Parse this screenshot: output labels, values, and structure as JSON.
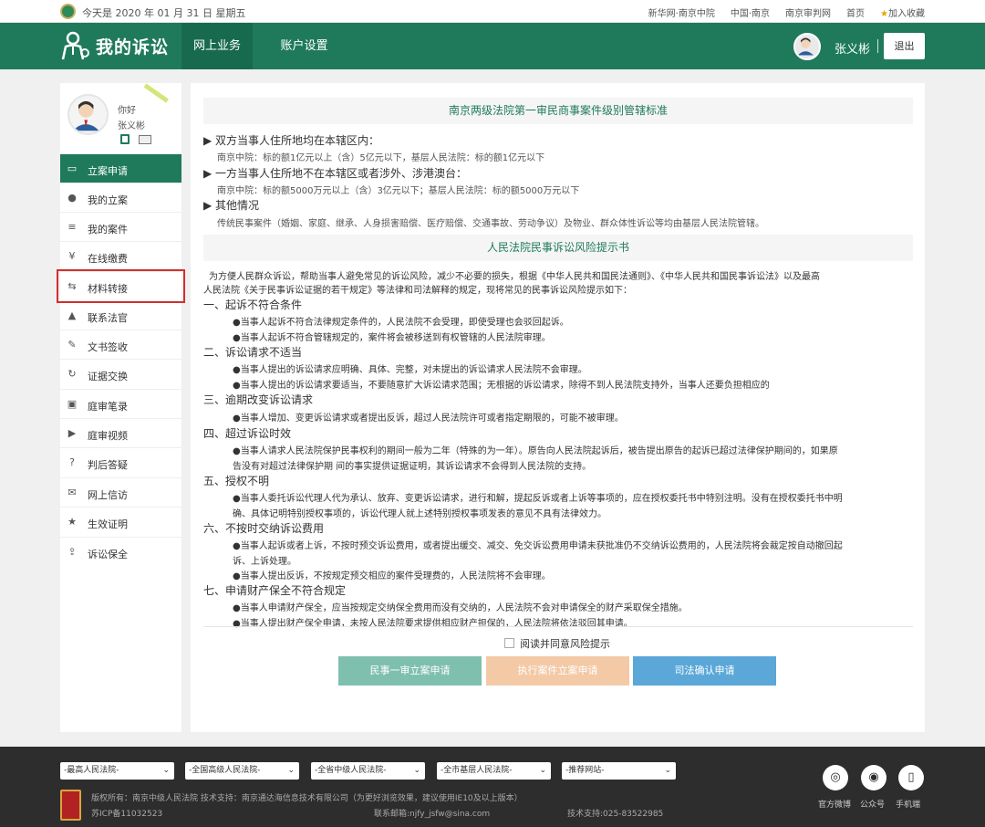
{
  "topbar": {
    "date": "今天是 2020 年 01 月 31 日 星期五",
    "links": [
      "新华网·南京中院",
      "中国·南京",
      "南京审判网",
      "首页"
    ],
    "favorite": "加入收藏"
  },
  "header": {
    "title": "我的诉讼",
    "tabs": [
      "网上业务",
      "账户设置"
    ],
    "user_name": "张义彬",
    "logout": "退出"
  },
  "sidebar": {
    "greeting": "你好",
    "name": "张义彬",
    "items": [
      {
        "label": "立案申请",
        "icon": "monitor-icon"
      },
      {
        "label": "我的立案",
        "icon": "user-icon"
      },
      {
        "label": "我的案件",
        "icon": "document-icon"
      },
      {
        "label": "在线缴费",
        "icon": "yen-icon"
      },
      {
        "label": "材料转接",
        "icon": "transfer-icon"
      },
      {
        "label": "联系法官",
        "icon": "contacts-icon"
      },
      {
        "label": "文书签收",
        "icon": "edit-icon"
      },
      {
        "label": "证据交换",
        "icon": "refresh-icon"
      },
      {
        "label": "庭审笔录",
        "icon": "notes-icon"
      },
      {
        "label": "庭审视频",
        "icon": "video-icon"
      },
      {
        "label": "判后答疑",
        "icon": "question-icon"
      },
      {
        "label": "网上信访",
        "icon": "mail-icon"
      },
      {
        "label": "生效证明",
        "icon": "star-icon"
      },
      {
        "label": "诉讼保全",
        "icon": "upload-icon"
      }
    ]
  },
  "main": {
    "section1_title": "南京两级法院第一审民商事案件级别管辖标准",
    "s1": [
      "▶ 双方当事人住所地均在本辖区内：",
      "南京中院：标的额1亿元以上（含）5亿元以下，基层人民法院：标的额1亿元以下",
      "▶ 一方当事人住所地不在本辖区或者涉外、涉港澳台：",
      "南京中院：标的额5000万元以上（含）3亿元以下；基层人民法院：标的额5000万元以下",
      "▶ 其他情况",
      "传统民事案件（婚姻、家庭、继承、人身损害赔偿、医疗赔偿、交通事故、劳动争议）及物业、群众体性诉讼等均由基层人民法院管辖。"
    ],
    "section2_title": "人民法院民事诉讼风险提示书",
    "intro": [
      "为方便人民群众诉讼，帮助当事人避免常见的诉讼风险，减少不必要的损失，根据《中华人民共和国民法通则》、《中华人民共和国民事诉讼法》以及最高",
      "人民法院《关于民事诉讼证据的若干规定》等法律和司法解释的规定，现将常见的民事诉讼风险提示如下："
    ],
    "points": [
      {
        "title": "一、起诉不符合条件",
        "lines": [
          "●当事人起诉不符合法律规定条件的，人民法院不会受理，即使受理也会驳回起诉。",
          "●当事人起诉不符合管辖规定的，案件将会被移送到有权管辖的人民法院审理。"
        ]
      },
      {
        "title": "二、诉讼请求不适当",
        "lines": [
          "●当事人提出的诉讼请求应明确、具体、完整，对未提出的诉讼请求人民法院不会审理。",
          "●当事人提出的诉讼请求要适当，不要随意扩大诉讼请求范围；无根据的诉讼请求，除得不到人民法院支持外，当事人还要负担相应的"
        ]
      },
      {
        "title": "三、逾期改变诉讼请求",
        "lines": [
          "●当事人增加、变更诉讼请求或者提出反诉，超过人民法院许可或者指定期限的，可能不被审理。"
        ]
      },
      {
        "title": "四、超过诉讼时效",
        "lines": [
          "●当事人请求人民法院保护民事权利的期间一般为二年（特殊的为一年）。原告向人民法院起诉后，被告提出原告的起诉已超过法律保护期间的，如果原",
          "告没有对超过法律保护期 间的事实提供证据证明，其诉讼请求不会得到人民法院的支持。"
        ]
      },
      {
        "title": "五、授权不明",
        "lines": [
          "●当事人委托诉讼代理人代为承认、放弃、变更诉讼请求，进行和解，提起反诉或者上诉等事项的，应在授权委托书中特别注明。没有在授权委托书中明",
          "确、具体记明特别授权事项的，诉讼代理人就上述特别授权事项发表的意见不具有法律效力。"
        ]
      },
      {
        "title": "六、不按时交纳诉讼费用",
        "lines": [
          "●当事人起诉或者上诉，不按时预交诉讼费用，或者提出缓交、减交、免交诉讼费用申请未获批准仍不交纳诉讼费用的，人民法院将会裁定按自动撤回起",
          "诉、上诉处理。",
          "●当事人提出反诉，不按规定预交相应的案件受理费的，人民法院将不会审理。"
        ]
      },
      {
        "title": "七、申请财产保全不符合规定",
        "lines": [
          "●当事人申请财产保全，应当按规定交纳保全费用而没有交纳的，人民法院不会对申请保全的财产采取保全措施。",
          "●当事人提出财产保全申请，未按人民法院要求提供相应财产担保的，人民法院将依法驳回其申请。"
        ]
      }
    ],
    "agree_label": "阅读并同意风险提示",
    "buttons": [
      "民事一审立案申请",
      "执行案件立案申请",
      "司法确认申请"
    ],
    "button_colors": [
      "#7fbfae",
      "#f3c9a6",
      "#5aa7d8"
    ]
  },
  "footer": {
    "selects": [
      "-最高人民法院-",
      "-全国高级人民法院-",
      "-全省中级人民法院-",
      "-全市基层人民法院-",
      "-推荐网站-"
    ],
    "copyright": "版权所有：南京中级人民法院 技术支持：南京通达海信息技术有限公司（为更好浏览效果，建议使用IE10及以上版本）",
    "icp": "苏ICP备11032523",
    "email": "联系邮箱:njfy_jsfw@sina.com",
    "phone": "技术支持:025-83522985",
    "social": [
      "官方微博",
      "公众号",
      "手机端"
    ]
  },
  "colors": {
    "brand_green": "#1f7a5c",
    "highlight_red": "#d32f2f"
  }
}
